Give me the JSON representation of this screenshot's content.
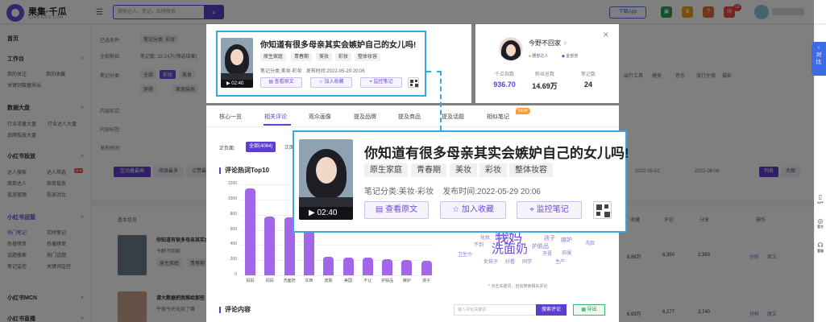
{
  "brand": {
    "name": "果集·千瓜",
    "sub": "QIAN-GUA.COM"
  },
  "search": {
    "placeholder": "搜索达人、笔记、品牌搜索"
  },
  "topbar": {
    "download": "下载App",
    "badge_count": "19"
  },
  "sidebar": {
    "home": "首页",
    "workbench": {
      "title": "工作台",
      "links": [
        "我的关注",
        "我的收藏",
        "关键词数据导出"
      ]
    },
    "data_dashboard": {
      "title": "数据大盘",
      "links": [
        "行业流量大盘",
        "行业达人大盘",
        "品牌投放大盘"
      ]
    },
    "xhs_ads": {
      "title": "小红书投放",
      "links": [
        "达人搜索",
        "达人筛选",
        "商单达人",
        "商单投放",
        "投放管理",
        "投放对比"
      ],
      "tag": "NEW"
    },
    "xhs_ops": {
      "title": "小红书运营",
      "links": [
        "热门笔记",
        "实时笔记",
        "热搜榜单",
        "热播榜单",
        "话题搜索",
        "热门话题",
        "笔记监控",
        "关键词监控"
      ]
    },
    "mcn": {
      "title": "小红书MCN"
    },
    "live": {
      "title": "小红书直播"
    }
  },
  "background": {
    "labels": [
      "已选条件:",
      "全部粉丝:",
      "笔记分类:",
      "内容形式:",
      "内容标签:",
      "发布时间:"
    ],
    "chips": [
      "笔记分类: 彩妆",
      "笔记数: 12.24万(筛选结果)"
    ],
    "categories": [
      "全部",
      "彩妆",
      "美食",
      "穿搭",
      "家居装修",
      "母婴育儿",
      "宠物生活",
      "影视",
      "出行工具",
      "健身",
      "音乐",
      "旅行住宿",
      "摄影"
    ],
    "sort": [
      "互动量最高",
      "阅读最多",
      "点赞最多"
    ],
    "date_range": [
      "2022-05-01",
      "2022-06-06"
    ],
    "view": [
      "列表",
      "大图"
    ],
    "table_headers": [
      "基本信息",
      "收藏",
      "评论",
      "分享",
      "操作"
    ],
    "rows": [
      {
        "title": "你知道有很多母亲其实会嫉妒自己的女儿吗！",
        "author": "今野不回家",
        "tags": [
          "原生家庭",
          "青春期"
        ],
        "collect": "8.86万",
        "comments": "6,350",
        "shares": "2,363"
      },
      {
        "title": "请大数据把我推给那些",
        "author": "午夜今天化妆了嘛",
        "collect": "6.99万",
        "comments": "6,277",
        "shares": "3,740"
      }
    ],
    "row_actions": [
      "分析",
      "原文"
    ]
  },
  "note": {
    "title": "你知道有很多母亲其实会嫉妒自己的女儿吗!",
    "tags": [
      "原生家庭",
      "青春期",
      "美妆",
      "彩妆",
      "整体妆容"
    ],
    "category_label": "笔记分类:",
    "category": "美妆-彩妆",
    "publish_label": "发布时间:",
    "publish_time": "2022-05-29 20:06",
    "duration": "02:40",
    "actions": {
      "view": "查看原文",
      "collect": "加入收藏",
      "monitor": "监控笔记"
    }
  },
  "author": {
    "name": "今野不回家",
    "badges": [
      "腰部达人",
      "金部普"
    ],
    "stats": [
      {
        "label": "千瓜指数",
        "value": "936.70"
      },
      {
        "label": "粉丝总数",
        "value": "14.69万"
      },
      {
        "label": "笔记数",
        "value": "24"
      }
    ]
  },
  "detail": {
    "tabs": [
      "核心一览",
      "相关评论",
      "观众画像",
      "提及品牌",
      "提及商品",
      "提及话题",
      "相似笔记"
    ],
    "new_badge": "NEW",
    "filter_label": "正负面:",
    "filter_all": "全部(4064)",
    "filter_other": "正面",
    "hot_words_title": "评论热词Top10",
    "comments_title": "评论内容",
    "cloud_note": "* 点击关键词，自动搜索相关评论",
    "comment_search_placeholder": "输入评论关键词",
    "comment_search_btn": "搜索评论",
    "export_btn": "导出"
  },
  "chart_data": {
    "type": "bar",
    "title": "评论热词Top10",
    "categories": [
      "妈妈",
      "妈妈",
      "洗面奶",
      "东西",
      "皮肤",
      "美国",
      "不让",
      "护肤品",
      "嫉妒",
      "孩子"
    ],
    "values": [
      1150,
      780,
      760,
      720,
      240,
      235,
      230,
      215,
      205,
      195
    ],
    "ylim": [
      0,
      1200
    ],
    "yticks": [
      0,
      200,
      400,
      600,
      800,
      1000,
      1200
    ],
    "bar_color": "#a266e8"
  },
  "word_cloud": [
    {
      "text": "洗面奶",
      "size": 15
    },
    {
      "text": "我妈",
      "size": 17
    },
    {
      "text": "面膜",
      "size": 9
    },
    {
      "text": "化妆",
      "size": 6
    },
    {
      "text": "不到",
      "size": 6
    },
    {
      "text": "卫生巾",
      "size": 6
    },
    {
      "text": "女孩子",
      "size": 6
    },
    {
      "text": "好看",
      "size": 6
    },
    {
      "text": "同学",
      "size": 6
    },
    {
      "text": "护肤品",
      "size": 7
    },
    {
      "text": "孩子",
      "size": 7
    },
    {
      "text": "嫉妒",
      "size": 7
    },
    {
      "text": "牙膏",
      "size": 6
    },
    {
      "text": "衣服",
      "size": 6
    },
    {
      "text": "生产",
      "size": 6
    },
    {
      "text": "洗脸",
      "size": 6
    }
  ],
  "right_rail": {
    "compare": "对比",
    "items": [
      "APP",
      "官方",
      "客服"
    ]
  }
}
